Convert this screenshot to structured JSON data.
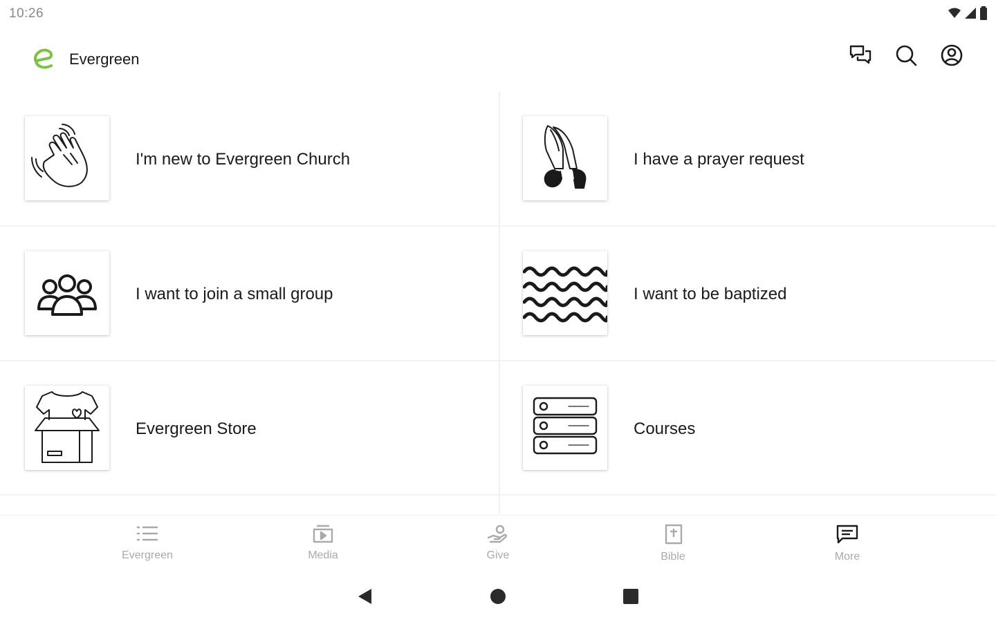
{
  "status_bar": {
    "time": "10:26",
    "icons": [
      "wifi-icon",
      "cellular-signal-icon",
      "battery-icon"
    ]
  },
  "app_bar": {
    "logo_icon": "evergreen-logo-icon",
    "title": "Evergreen",
    "actions": [
      {
        "name": "chat-button",
        "icon": "chat-bubbles-icon"
      },
      {
        "name": "search-button",
        "icon": "search-icon"
      },
      {
        "name": "profile-button",
        "icon": "account-circle-icon"
      }
    ]
  },
  "tiles": [
    {
      "label": "I'm new to Evergreen Church",
      "icon": "waving-hand-icon"
    },
    {
      "label": "I have a prayer request",
      "icon": "praying-hands-icon"
    },
    {
      "label": "I want to join a small group",
      "icon": "group-people-icon"
    },
    {
      "label": "I want to be baptized",
      "icon": "water-waves-icon"
    },
    {
      "label": "Evergreen Store",
      "icon": "store-box-shirt-icon"
    },
    {
      "label": "Courses",
      "icon": "courses-list-icon"
    }
  ],
  "bottom_nav": [
    {
      "label": "Evergreen",
      "icon": "list-icon"
    },
    {
      "label": "Media",
      "icon": "media-play-icon"
    },
    {
      "label": "Give",
      "icon": "give-hand-icon"
    },
    {
      "label": "Bible",
      "icon": "bible-icon"
    },
    {
      "label": "More",
      "icon": "more-message-icon"
    }
  ],
  "colors": {
    "brand": "#7cc242",
    "text": "#1a1a1a",
    "nav_inactive": "#a9a9a9",
    "divider": "#f0f0f0"
  }
}
